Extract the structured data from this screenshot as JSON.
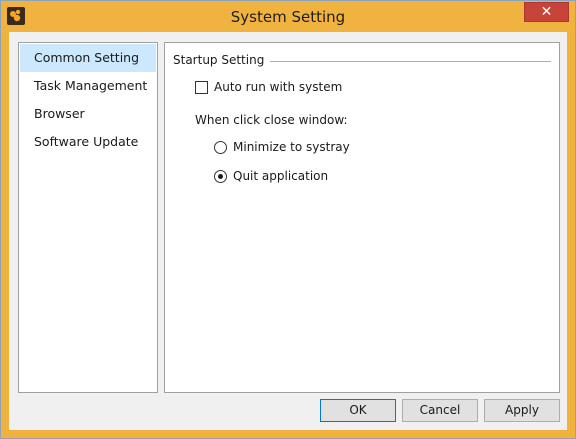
{
  "window": {
    "title": "System Setting",
    "close_glyph": "✕",
    "accent_color": "#f1b33f"
  },
  "sidebar": {
    "items": [
      {
        "label": "Common Setting",
        "selected": true
      },
      {
        "label": "Task Management",
        "selected": false
      },
      {
        "label": "Browser",
        "selected": false
      },
      {
        "label": "Software Update",
        "selected": false
      }
    ]
  },
  "startup": {
    "group_title": "Startup Setting",
    "auto_run_label": "Auto run with system",
    "auto_run_checked": false,
    "close_window_label": "When click close window:",
    "options": [
      {
        "label": "Minimize to systray",
        "checked": false
      },
      {
        "label": "Quit application",
        "checked": true
      }
    ]
  },
  "buttons": {
    "ok": "OK",
    "cancel": "Cancel",
    "apply": "Apply"
  }
}
